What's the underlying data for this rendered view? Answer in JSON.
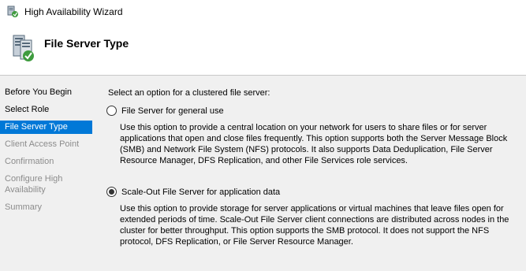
{
  "window": {
    "title": "High Availability Wizard"
  },
  "header": {
    "page_title": "File Server Type"
  },
  "nav": {
    "items": [
      {
        "label": "Before You Begin"
      },
      {
        "label": "Select Role"
      },
      {
        "label": "File Server Type"
      },
      {
        "label": "Client Access Point"
      },
      {
        "label": "Confirmation"
      },
      {
        "label": "Configure High Availability"
      },
      {
        "label": "Summary"
      }
    ],
    "selected_label": "File Server Type"
  },
  "main": {
    "prompt": "Select an option for a clustered file server:",
    "options": [
      {
        "label": "File Server for general use",
        "selected": false,
        "description": "Use this option to provide a central location on your network for users to share files or for server applications that open and close files frequently. This option supports both the Server Message Block (SMB) and Network File System (NFS) protocols. It also supports Data Deduplication, File Server Resource Manager, DFS Replication, and other File Services role services."
      },
      {
        "label": "Scale-Out File Server for application data",
        "selected": true,
        "description": "Use this option to provide storage for server applications or virtual machines that leave files open for extended periods of time. Scale-Out File Server client connections are distributed across nodes in the cluster for better throughput. This option supports the SMB protocol. It does not support the NFS protocol, DFS Replication, or File Server Resource Manager."
      }
    ]
  },
  "colors": {
    "nav_selected_bg": "#0078d7",
    "panel_bg": "#f0f0f0",
    "disabled_text": "#8c8c8c"
  }
}
